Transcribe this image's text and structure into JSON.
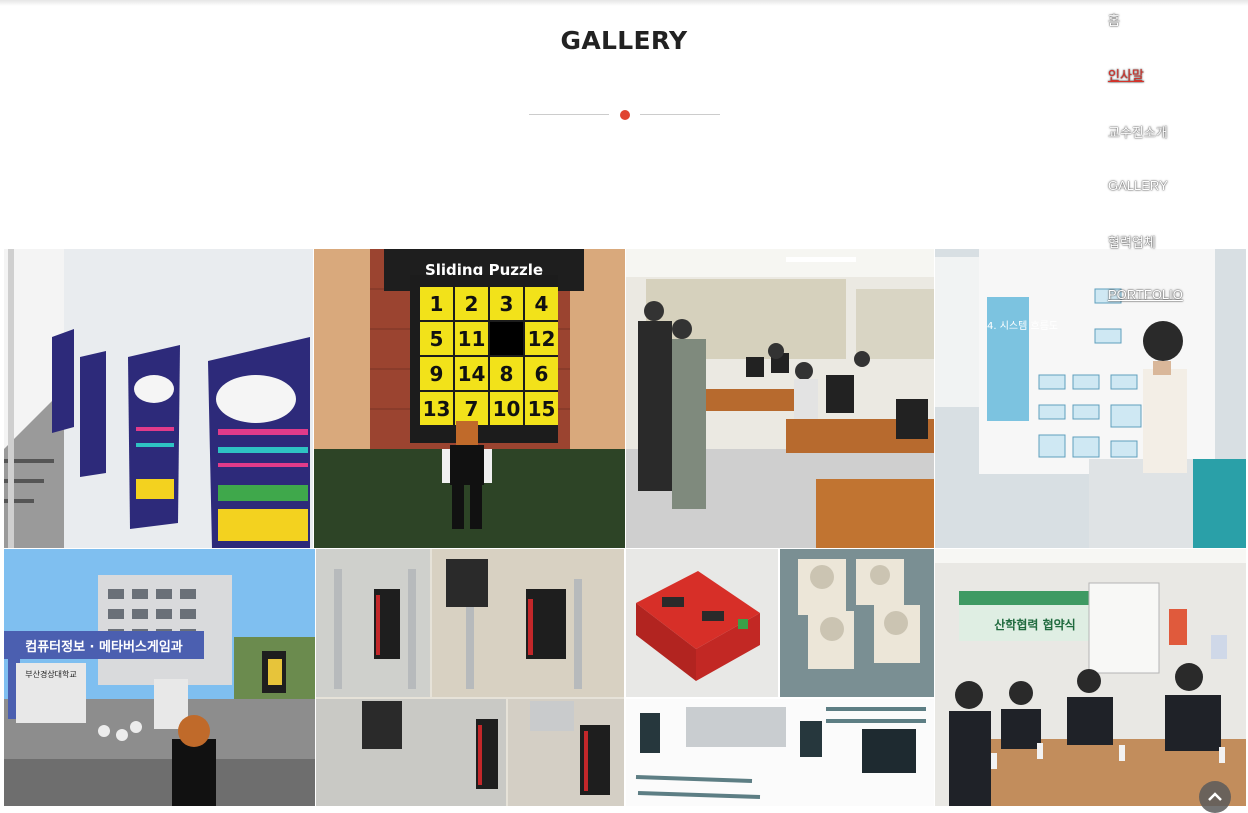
{
  "gallery": {
    "title": "GALLERY",
    "accent_color": "#e0432f"
  },
  "nav": {
    "items": [
      {
        "label": "홈",
        "active": false
      },
      {
        "label": "인사말",
        "active": true
      },
      {
        "label": "교수진소개",
        "active": false
      },
      {
        "label": "GALLERY",
        "active": false
      },
      {
        "label": "협력업체",
        "active": false
      },
      {
        "label": "PORTFOLIO",
        "active": false
      }
    ],
    "active_color": "#d6322a"
  },
  "photos": {
    "sliding_puzzle": {
      "sign": "Sliding Puzzle",
      "tiles": [
        "1",
        "2",
        "3",
        "4",
        "5",
        "11",
        "",
        "12",
        "9",
        "14",
        "8",
        "6",
        "13",
        "7",
        "10",
        "15"
      ]
    },
    "presentation_slide": {
      "heading": "4. 시스템 흐름도"
    },
    "metaverse_campus": {
      "banner": "컴퓨터정보 · 메타버스게임과",
      "board": "부산경상대학교"
    },
    "mou_ceremony": {
      "banner": "산학협력 협약식"
    }
  },
  "scroll_top_icon": "chevron-up-icon"
}
